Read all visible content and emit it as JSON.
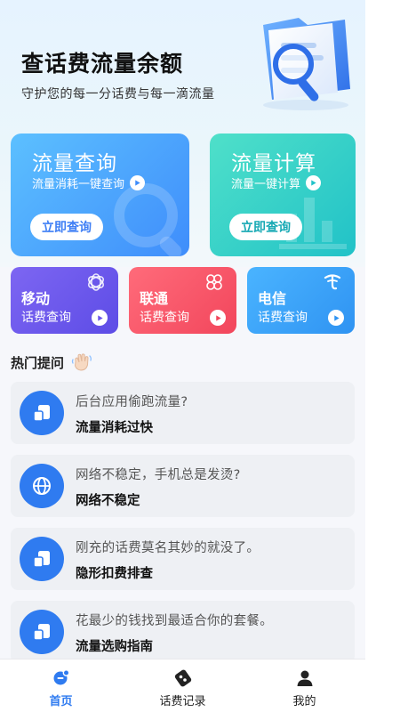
{
  "header": {
    "title": "查话费流量余额",
    "subtitle": "守护您的每一分话费与每一滴流量"
  },
  "cards": [
    {
      "title": "流量查询",
      "desc": "流量消耗一键查询",
      "button": "立即查询"
    },
    {
      "title": "流量计算",
      "desc": "流量一键计算",
      "button": "立即查询"
    }
  ],
  "operators": [
    {
      "name": "移动",
      "sub": "话费查询"
    },
    {
      "name": "联通",
      "sub": "话费查询"
    },
    {
      "name": "电信",
      "sub": "话费查询"
    }
  ],
  "hot": {
    "title": "热门提问",
    "items": [
      {
        "question": "后台应用偷跑流量?",
        "topic": "流量消耗过快"
      },
      {
        "question": "网络不稳定，手机总是发烫?",
        "topic": "网络不稳定"
      },
      {
        "question": "刚充的话费莫名其妙的就没了。",
        "topic": "隐形扣费排查"
      },
      {
        "question": "花最少的钱找到最适合你的套餐。",
        "topic": "流量选购指南"
      }
    ]
  },
  "tabs": [
    {
      "label": "首页",
      "active": true
    },
    {
      "label": "话费记录",
      "active": false
    },
    {
      "label": "我的",
      "active": false
    }
  ],
  "colors": {
    "accent": "#2f7bf0",
    "card_blue": "#3f8dfb",
    "card_teal": "#21c2c8",
    "mobile": "#6a56ec",
    "unicom": "#f2465c",
    "telecom": "#2f93f2"
  },
  "icons": {
    "hero": "document-folder-magnifier-icon",
    "card_query": "play-circle-icon",
    "mobile": "china-mobile-logo-icon",
    "unicom": "china-unicom-logo-icon",
    "telecom": "china-telecom-logo-icon",
    "hot": "waving-hand-icon",
    "q1": "app-layers-icon",
    "q2": "globe-icon",
    "q3": "app-layers-icon",
    "q4": "app-layers-icon",
    "tab_home": "home-icon",
    "tab_records": "records-icon",
    "tab_profile": "user-icon"
  }
}
